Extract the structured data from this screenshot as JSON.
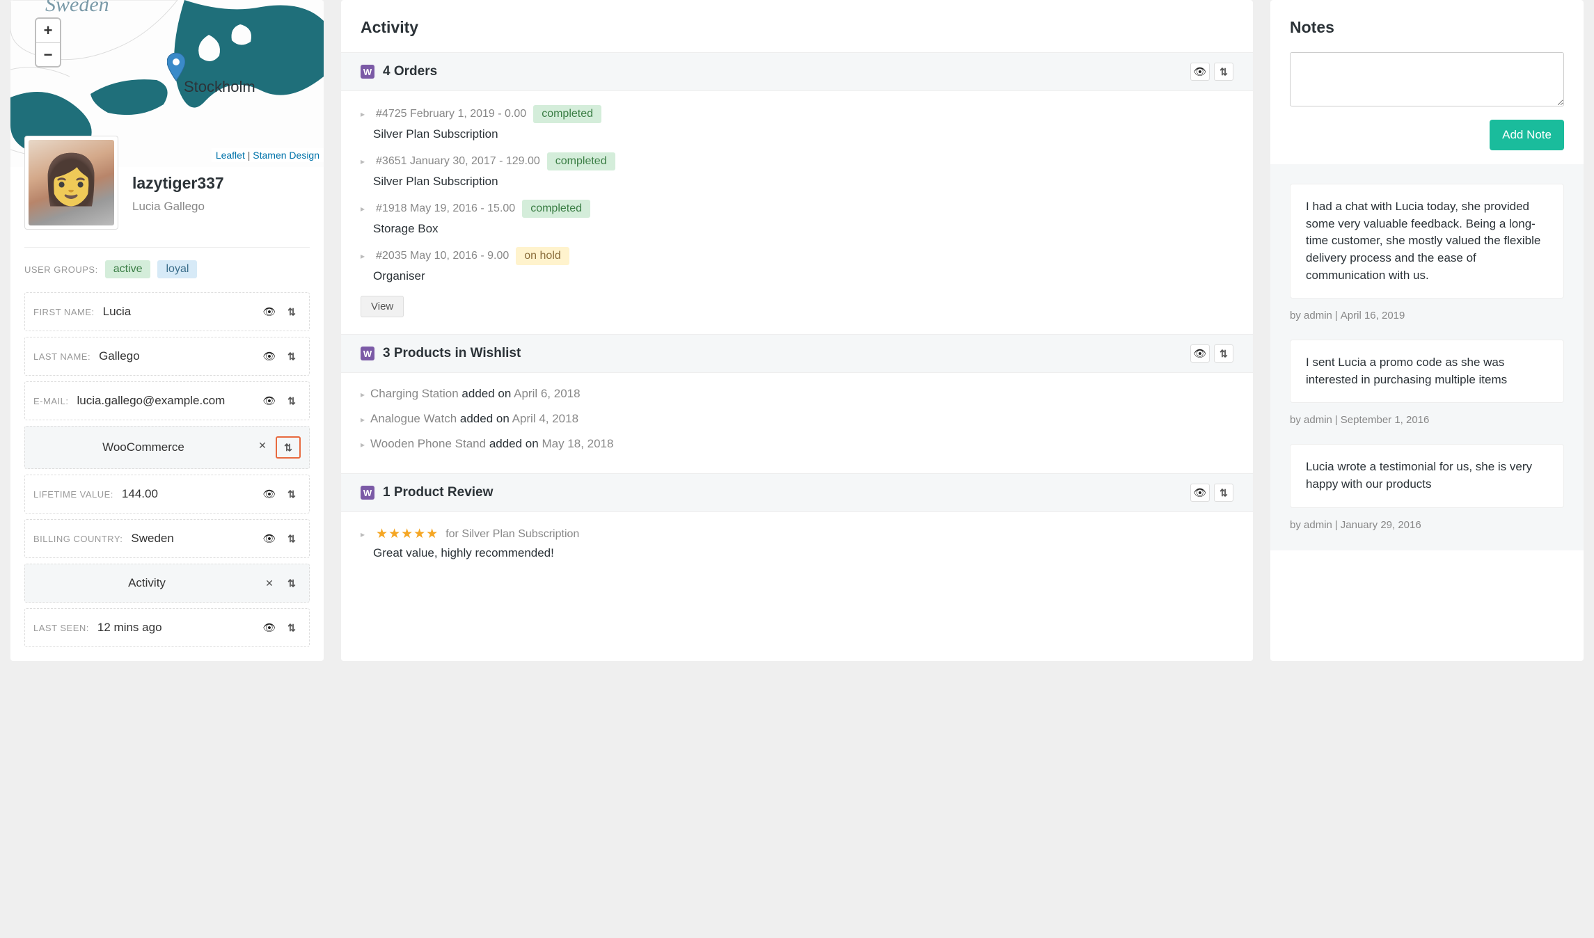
{
  "map": {
    "country_label": "Sweden",
    "city_label": "Stockholm",
    "attribution_leaflet": "Leaflet",
    "attribution_stamen": "Stamen Design"
  },
  "profile": {
    "username": "lazytiger337",
    "fullname": "Lucia Gallego",
    "groups_label": "USER GROUPS:",
    "groups": [
      "active",
      "loyal"
    ],
    "fields": {
      "first_name_label": "FIRST NAME:",
      "first_name": "Lucia",
      "last_name_label": "LAST NAME:",
      "last_name": "Gallego",
      "email_label": "E-MAIL:",
      "email": "lucia.gallego@example.com",
      "section_woo": "WooCommerce",
      "lifetime_label": "LIFETIME VALUE:",
      "lifetime": "144.00",
      "billing_country_label": "BILLING COUNTRY:",
      "billing_country": "Sweden",
      "section_activity": "Activity",
      "last_seen_label": "LAST SEEN:",
      "last_seen": "12 mins ago"
    }
  },
  "activity": {
    "title": "Activity",
    "w_badge": "W",
    "orders_title": "4 Orders",
    "orders": [
      {
        "id": "#4725",
        "date": "February 1, 2019",
        "amount": "0.00",
        "status": "completed",
        "product": "Silver Plan Subscription"
      },
      {
        "id": "#3651",
        "date": "January 30, 2017",
        "amount": "129.00",
        "status": "completed",
        "product": "Silver Plan Subscription"
      },
      {
        "id": "#1918",
        "date": "May 19, 2016",
        "amount": "15.00",
        "status": "completed",
        "product": "Storage Box"
      },
      {
        "id": "#2035",
        "date": "May 10, 2016",
        "amount": "9.00",
        "status": "on hold",
        "product": "Organiser"
      }
    ],
    "view_label": "View",
    "wishlist_title": "3 Products in Wishlist",
    "added_on": "added on",
    "wishlist": [
      {
        "name": "Charging Station",
        "date": "April 6, 2018"
      },
      {
        "name": "Analogue Watch",
        "date": "April 4, 2018"
      },
      {
        "name": "Wooden Phone Stand",
        "date": "May 18, 2018"
      }
    ],
    "reviews_title": "1 Product Review",
    "review": {
      "stars": "★★★★★",
      "for_text": "for",
      "product": "Silver Plan Subscription",
      "body": "Great value, highly recommended!"
    }
  },
  "notes": {
    "title": "Notes",
    "add_button": "Add Note",
    "by_label": "by",
    "items": [
      {
        "body": "I had a chat with Lucia today, she provided some very valuable feedback. Being a long-time customer, she mostly valued the flexible delivery process and the ease of communication with us.",
        "author": "admin",
        "date": "April 16, 2019"
      },
      {
        "body": "I sent Lucia a promo code as she was interested in purchasing multiple items",
        "author": "admin",
        "date": "September 1, 2016"
      },
      {
        "body": "Lucia wrote a testimonial for us, she is very happy with our products",
        "author": "admin",
        "date": "January 29, 2016"
      }
    ]
  }
}
